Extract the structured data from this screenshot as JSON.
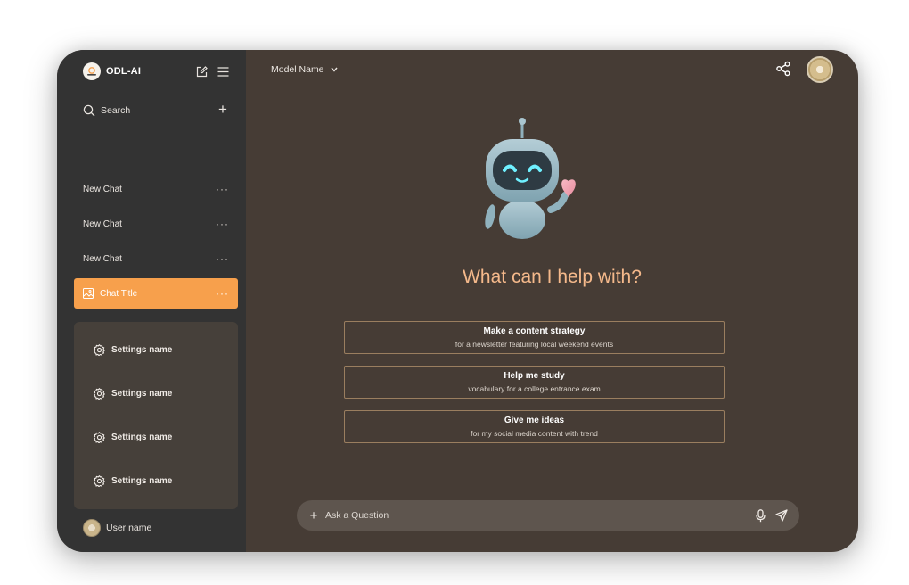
{
  "brand": {
    "name": "ODL-AI",
    "accent": "#f7a04c"
  },
  "sidebar": {
    "search_label": "Search",
    "chats": [
      {
        "label": "New Chat"
      },
      {
        "label": "New Chat"
      },
      {
        "label": "New Chat"
      },
      {
        "label": "Chat Title",
        "active": true
      }
    ],
    "more_label": "···",
    "settings": [
      {
        "label": "Settings name"
      },
      {
        "label": "Settings name"
      },
      {
        "label": "Settings name"
      },
      {
        "label": "Settings name"
      }
    ],
    "user_name": "User name"
  },
  "header": {
    "model_label": "Model Name"
  },
  "main": {
    "headline": "What can I help with?",
    "suggestions": [
      {
        "title": "Make a content strategy",
        "subtitle": "for a newsletter featuring local weekend events"
      },
      {
        "title": "Help me study",
        "subtitle": "vocabulary for a college entrance exam"
      },
      {
        "title": "Give me ideas",
        "subtitle": "for my social media content with trend"
      }
    ],
    "input_placeholder": "Ask a Question"
  },
  "icons": {
    "logo": "odl-logo-icon",
    "new_chat": "edit-icon",
    "menu": "hamburger-icon",
    "search": "search-icon",
    "add": "plus-icon",
    "chat": "image-icon",
    "settings": "gear-icon",
    "model_dropdown": "chevron-down-icon",
    "share": "share-icon",
    "mic": "mic-icon",
    "send": "send-icon"
  }
}
